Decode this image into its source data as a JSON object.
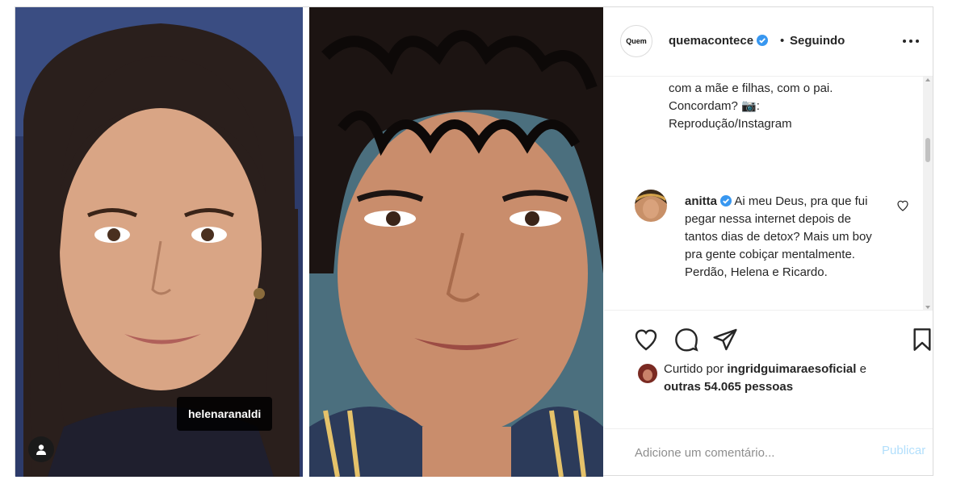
{
  "post": {
    "author": {
      "username": "quemacontece",
      "avatar_text": "Quem",
      "verified": true
    },
    "separator": "•",
    "follow_status": "Seguindo",
    "more_icon": "more-horizontal-icon",
    "caption_lines": [
      "com a mãe e filhas, com o pai.",
      "Concordam? 📷:",
      "Reprodução/Instagram"
    ],
    "media": {
      "left_photo": "woman-portrait",
      "right_photo": "young-man-portrait",
      "tag_label": "helenaranaldi",
      "user_tag_icon": "user-tag-icon"
    },
    "comment": {
      "username": "anitta",
      "verified": true,
      "text": "Ai meu Deus, pra que fui pegar nessa internet depois de tantos dias de detox? Mais um boy pra gente cobiçar mentalmente. Perdão, Helena e Ricardo.",
      "like_icon": "heart-outline-icon"
    },
    "actions": {
      "like_icon": "heart-outline-icon",
      "comment_icon": "comment-bubble-icon",
      "share_icon": "paper-plane-icon",
      "save_icon": "bookmark-icon"
    },
    "likes": {
      "prefix": "Curtido por",
      "liked_by": "ingridguimaraesoficial",
      "conjunction": "e",
      "others_line": "outras 54.065 pessoas"
    },
    "add_comment": {
      "placeholder": "Adicione um comentário...",
      "publish_label": "Publicar"
    },
    "colors": {
      "verified_blue": "#3897f0",
      "publish_disabled": "#b2dffc",
      "border": "#dbdbdb"
    }
  }
}
